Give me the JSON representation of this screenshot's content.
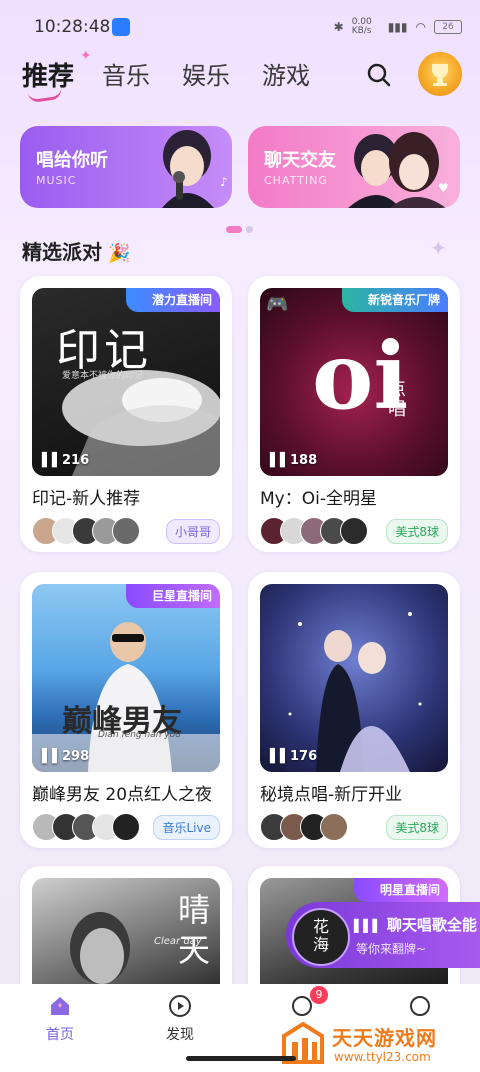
{
  "status_bar": {
    "time": "10:28:48",
    "net_speed": "0.00 KB/s",
    "battery": "26"
  },
  "tabs": [
    {
      "label": "推荐",
      "active": true
    },
    {
      "label": "音乐",
      "active": false
    },
    {
      "label": "娱乐",
      "active": false
    },
    {
      "label": "游戏",
      "active": false
    }
  ],
  "banners": [
    {
      "title": "唱给你听",
      "subtitle": "MUSIC"
    },
    {
      "title": "聊天交友",
      "subtitle": "CHATTING"
    }
  ],
  "section_title": "精选派对",
  "cards": [
    {
      "title": "印记-新人推荐",
      "count": "216",
      "badge": "潜力直播间",
      "tag": "小哥哥",
      "art_main": "印记",
      "art_sub": "爱意本不被你的印记"
    },
    {
      "title": "My：Oi-全明星",
      "count": "188",
      "badge": "新锐音乐厂牌",
      "tag": "美式8球",
      "art_main": "oi",
      "art_sub": "点唱"
    },
    {
      "title": "巅峰男友 20点红人之夜",
      "count": "298",
      "badge": "巨星直播间",
      "tag": "音乐Live",
      "art_main": "巅峰男友",
      "art_sub": "Dian feng nan you"
    },
    {
      "title": "秘境点唱-新厅开业",
      "count": "176",
      "badge": "",
      "tag": "美式8球",
      "art_main": "",
      "art_sub": ""
    },
    {
      "title": "",
      "count": "",
      "badge": "",
      "tag": "",
      "art_main": "晴天",
      "art_sub": "Clear day"
    },
    {
      "title": "",
      "count": "",
      "badge": "明星直播间",
      "tag": "",
      "art_main": "花海",
      "art_sub": ""
    }
  ],
  "floating": {
    "line1": "聊天唱歌全能",
    "line2": "等你来翻牌~"
  },
  "nav": [
    {
      "label": "首页",
      "active": true
    },
    {
      "label": "发现",
      "active": false
    }
  ],
  "nav_badge": "9",
  "watermark": {
    "title": "天天游戏网",
    "url": "www.ttyl23.com"
  },
  "colors": {
    "accent": "#e24f9d",
    "nav_active": "#7a63d9",
    "pill": "#8a45e0"
  }
}
